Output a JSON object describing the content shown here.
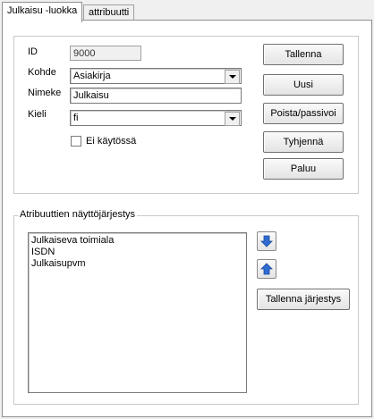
{
  "tabs": [
    {
      "label": "Julkaisu -luokka",
      "active": true
    },
    {
      "label": "attribuutti",
      "active": false
    }
  ],
  "form": {
    "id_label": "ID",
    "id_value": "9000",
    "kohde_label": "Kohde",
    "kohde_value": "Asiakirja",
    "nimeke_label": "Nimeke",
    "nimeke_value": "Julkaisu",
    "kieli_label": "Kieli",
    "kieli_value": "fi",
    "checkbox_label": "Ei käytössä",
    "checkbox_checked": false
  },
  "buttons": {
    "save": "Tallenna",
    "new": "Uusi",
    "delete": "Poista/passivoi",
    "clear": "Tyhjennä",
    "back": "Paluu"
  },
  "order_group": {
    "title": "Atribuuttien näyttöjärjestys",
    "items": [
      "Julkaiseva toimiala",
      "ISDN",
      "Julkaisupvm"
    ],
    "move_down_icon": "arrow-down-icon",
    "move_up_icon": "arrow-up-icon",
    "save_order": "Tallenna järjestys"
  },
  "colors": {
    "arrow_blue": "#2f6bd0"
  }
}
